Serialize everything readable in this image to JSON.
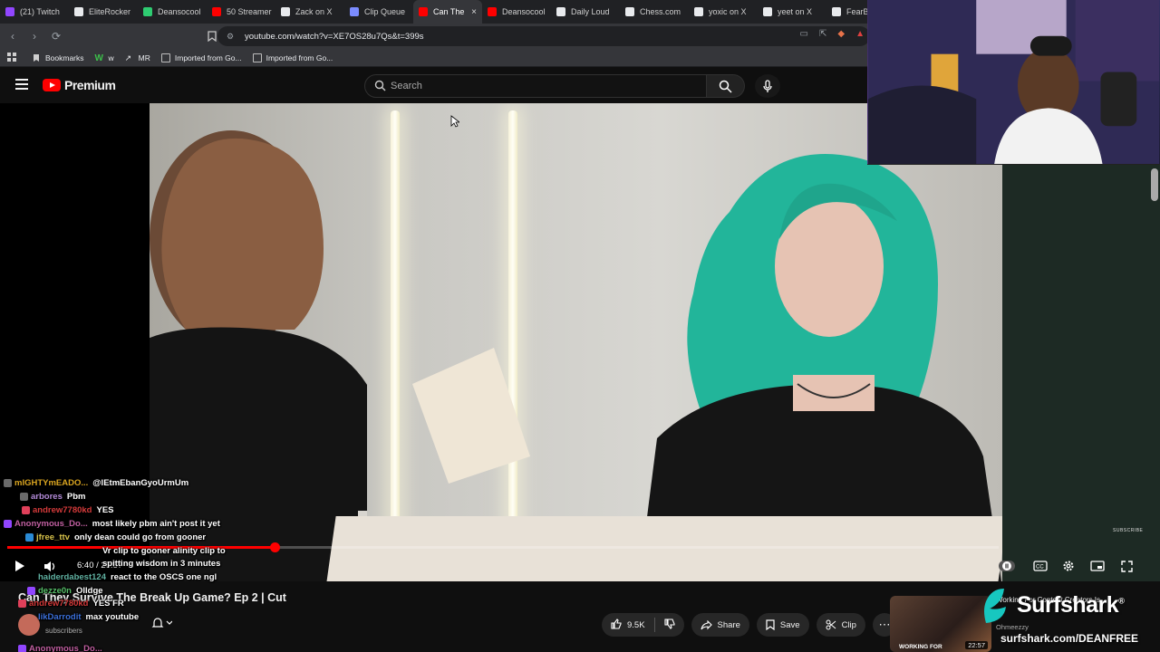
{
  "browser": {
    "tabs": [
      {
        "label": "(21) Twitch",
        "color": "#9146ff"
      },
      {
        "label": "EliteRocker",
        "color": "#e8eaed"
      },
      {
        "label": "Deansocool",
        "color": "#2ecc71"
      },
      {
        "label": "50 Streamer",
        "color": "#ff0000"
      },
      {
        "label": "Zack on X",
        "color": "#e8eaed"
      },
      {
        "label": "Clip Queue",
        "color": "#7b8cff"
      },
      {
        "label": "Can The",
        "color": "#ff0000"
      },
      {
        "label": "Deansocool",
        "color": "#ff0000"
      },
      {
        "label": "Daily Loud",
        "color": "#e8eaed"
      },
      {
        "label": "Chess.com",
        "color": "#e8eaed"
      },
      {
        "label": "yoxic on X",
        "color": "#e8eaed"
      },
      {
        "label": "yeet on X",
        "color": "#e8eaed"
      },
      {
        "label": "FearB",
        "color": "#e8eaed"
      }
    ],
    "active_tab_index": 6,
    "url": "youtube.com/watch?v=XE7OS28u7Qs&t=399s",
    "bookmarks": [
      {
        "label": "Bookmarks",
        "icon": "bookmark-icon"
      },
      {
        "label": "w",
        "icon": "w-icon"
      },
      {
        "label": "MR",
        "icon": "arrow-icon"
      },
      {
        "label": "Imported from Go...",
        "icon": "folder-icon"
      },
      {
        "label": "Imported from Go...",
        "icon": "folder-icon"
      }
    ]
  },
  "youtube": {
    "brand": "Premium",
    "search_placeholder": "Search",
    "video": {
      "title": "Can They Survive The Break Up Game? Ep 2 | Cut",
      "time": "6:40 / 25:57",
      "progress": 0.27,
      "watermark": "SUBSCRIBE"
    },
    "channel": {
      "subscribers": "subscribers"
    },
    "actions": {
      "likes": "9.5K",
      "share": "Share",
      "save": "Save",
      "clip": "Clip"
    }
  },
  "chat": [
    {
      "user": "mIGHTYmEADO...",
      "msg": "@lEtmEbanGyoUrmUm",
      "color": "#daa520",
      "badge": "#6a6a6a"
    },
    {
      "user": "arbores",
      "msg": "Pbm",
      "color": "#b38bd9",
      "badge": "#6a6a6a"
    },
    {
      "user": "andrew7780kd",
      "msg": "YES",
      "color": "#d43a3a",
      "badge": "#e0405a"
    },
    {
      "user": "Anonymous_Do...",
      "msg": "most likely pbm ain't post it yet",
      "color": "#c05fa0",
      "badge": "#9146ff"
    },
    {
      "user": "jfree_ttv",
      "msg": "only dean could go from gooner",
      "color": "#d6c14a",
      "badge": "#2a8ad4"
    },
    {
      "user": "",
      "msg": "Vr clip to gooner alinity clip to",
      "color": "#fff",
      "badge": ""
    },
    {
      "user": "",
      "msg": "spitting wisdom in 3 minutes",
      "color": "#fff",
      "badge": ""
    },
    {
      "user": "haiderdabest124",
      "msg": "react to the OSCS one ngl",
      "color": "#5fb0a0",
      "badge": ""
    },
    {
      "user": "dezze0n",
      "msg": "Olldge",
      "color": "#58c06a",
      "badge": "#9146ff"
    },
    {
      "user": "andrew7780kd",
      "msg": "YES FR",
      "color": "#d43a3a",
      "badge": "#e0405a"
    },
    {
      "user": "likDarrodit",
      "msg": "max youtube",
      "color": "#3b6fd8",
      "badge": ""
    },
    {
      "user": "Anonymous_Do...",
      "msg": "",
      "color": "#c05fa0",
      "badge": "#9146ff"
    }
  ],
  "ad": {
    "brand": "Surfshark",
    "url": "surfshark.com/DEANFREE",
    "info": "Working For Content Creators Is...",
    "channel": "Ohmeezzy",
    "duration": "22:57",
    "thumb_text": "WORKING FOR"
  }
}
